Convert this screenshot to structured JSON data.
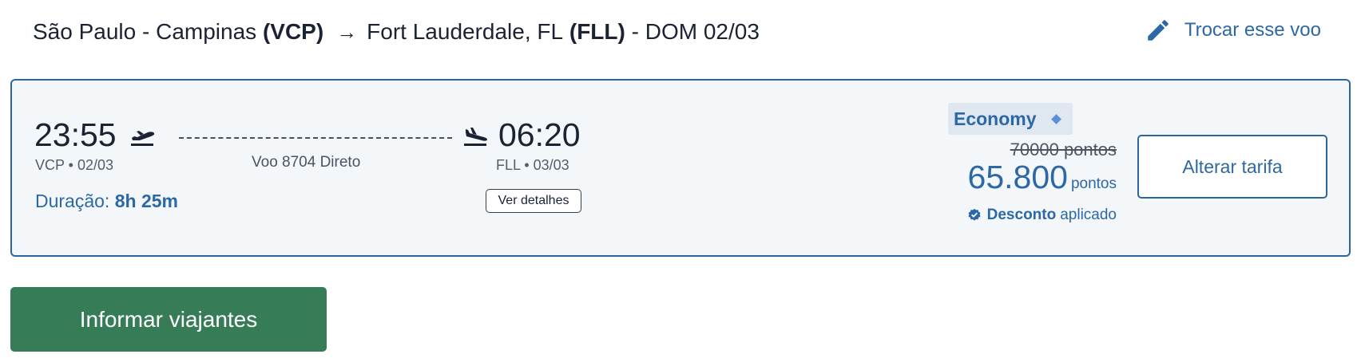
{
  "route": {
    "origin_city": "São Paulo - Campinas",
    "origin_code": "(VCP)",
    "arrow": "→",
    "destination_city": "Fort Lauderdale, FL",
    "destination_code": "(FLL)",
    "date_text": "- DOM 02/03"
  },
  "change_flight": {
    "label": "Trocar esse voo",
    "icon": "pencil-icon"
  },
  "flight": {
    "departure_time": "23:55",
    "departure_info": "VCP • 02/03",
    "arrival_time": "06:20",
    "arrival_info": "FLL • 03/03",
    "flight_info": "Voo 8704 Direto",
    "duration_label": "Duração:",
    "duration_value": "8h 25m",
    "details_label": "Ver detalhes",
    "takeoff_icon": "takeoff-icon",
    "landing_icon": "landing-icon"
  },
  "fare": {
    "cabin": "Economy",
    "original_price": "70000 pontos",
    "price_amount": "65.800",
    "price_unit": "pontos",
    "discount_label": "Desconto",
    "discount_suffix": "aplicado",
    "change_fare_label": "Alterar tarifa"
  },
  "actions": {
    "primary_label": "Informar viajantes"
  },
  "colors": {
    "accent_blue": "#2d68a6",
    "primary_green": "#367d57",
    "card_background": "#f4f7fa",
    "text_dark": "#1b2233"
  }
}
